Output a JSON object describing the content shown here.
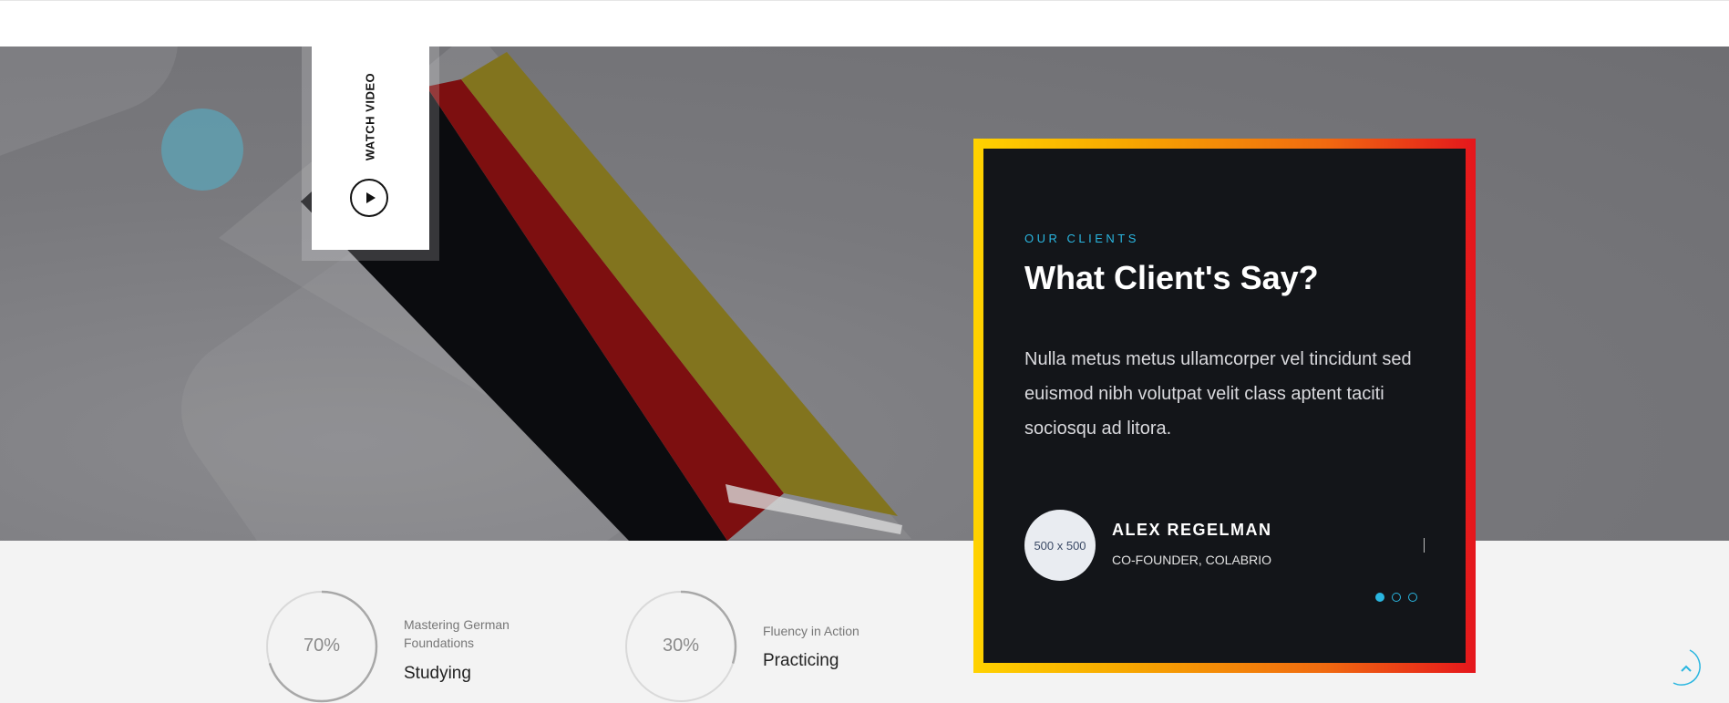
{
  "video": {
    "label": "WATCH VIDEO",
    "icon": "play-icon"
  },
  "testimonial": {
    "eyebrow": "OUR CLIENTS",
    "title": "What Client's Say?",
    "text": "Nulla metus metus ullamcorper vel tincidunt sed euismod nibh volutpat velit class aptent taciti sociosqu ad litora.",
    "avatar_placeholder": "500 x 500",
    "author": "ALEX REGELMAN",
    "role": "CO-FOUNDER, COLABRIO",
    "slides": 3,
    "active_slide": 1
  },
  "progress": [
    {
      "value": 70,
      "label": "70%",
      "subtitle": "Mastering German Foundations",
      "title": "Studying"
    },
    {
      "value": 30,
      "label": "30%",
      "subtitle": "Fluency in Action",
      "title": "Practicing"
    }
  ],
  "colors": {
    "accent": "#2ab6e0",
    "frame_gradient": [
      "#ffd200",
      "#f7a800",
      "#e5161c"
    ],
    "card_bg": "#131519",
    "flag": [
      "#0b0c0f",
      "#7d0f10",
      "#82741e"
    ]
  },
  "scroll_top": {
    "icon": "chevron-up-icon"
  }
}
